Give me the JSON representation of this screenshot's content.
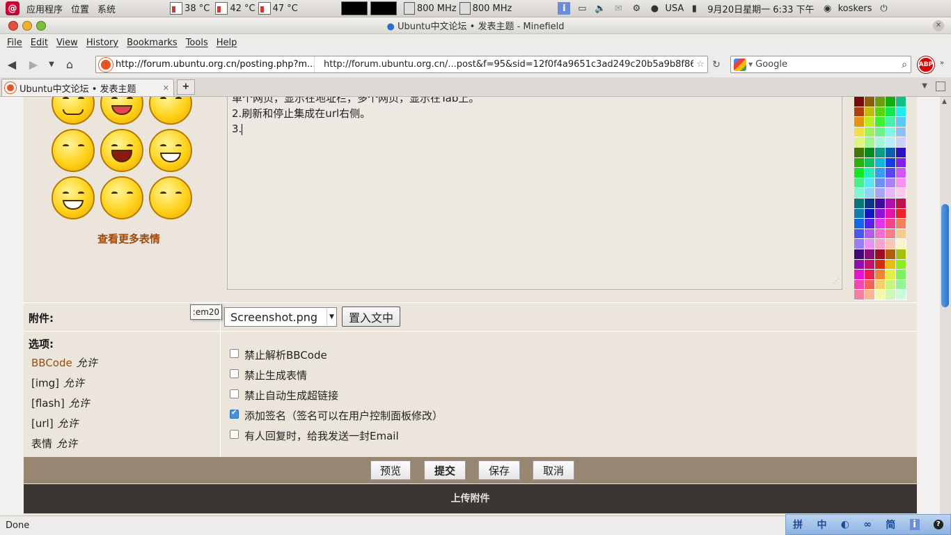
{
  "panel": {
    "apps": "应用程序",
    "places": "位置",
    "system": "系统",
    "temps": [
      "38 °C",
      "42 °C",
      "47 °C"
    ],
    "cpu_freqs": [
      "800 MHz",
      "800 MHz"
    ],
    "keyboard": "USA",
    "datetime": "9月20日星期一   6:33 下午",
    "user": "koskers"
  },
  "window": {
    "title": "Ubuntu中文论坛 • 发表主题 - Minefield"
  },
  "menu": [
    "File",
    "Edit",
    "View",
    "History",
    "Bookmarks",
    "Tools",
    "Help"
  ],
  "nav": {
    "url_short": "http://forum.ubuntu.org.cn/posting.php?m...",
    "url_full": "http://forum.ubuntu.org.cn/...post&f=95&sid=12f0f4a9651c3ad249c20b5a9b8f8629#",
    "search_placeholder": "Google",
    "abp": "ABP"
  },
  "tab": {
    "label": "Ubuntu中文论坛 • 发表主题"
  },
  "editor": {
    "lines": [
      "单个网页，显示在地址栏，多个网页，显示在Tab上。",
      "2.刷新和停止集成在url右侧。",
      "3."
    ]
  },
  "smileys": {
    "more_label": "查看更多表情",
    "tooltip": ":em20"
  },
  "attachment": {
    "label": "附件:",
    "file": "Screenshot.png",
    "place_button": "置入文中"
  },
  "options": {
    "label": "选项:",
    "perms": [
      {
        "key": "BBCode",
        "value": "允许"
      },
      {
        "key": "[img]",
        "value": "允许"
      },
      {
        "key": "[flash]",
        "value": "允许"
      },
      {
        "key": "[url]",
        "value": "允许"
      },
      {
        "key": "表情",
        "value": "允许"
      }
    ],
    "checks": [
      {
        "label": "禁止解析BBCode",
        "checked": false
      },
      {
        "label": "禁止生成表情",
        "checked": false
      },
      {
        "label": "禁止自动生成超链接",
        "checked": false
      },
      {
        "label": "添加签名（签名可以在用户控制面板修改）",
        "checked": true
      },
      {
        "label": "有人回复时，给我发送一封Email",
        "checked": false
      }
    ]
  },
  "buttons": {
    "preview": "预览",
    "submit": "提交",
    "save": "保存",
    "cancel": "取消"
  },
  "upload_header": "上传附件",
  "status": "Done",
  "ime": [
    "拼",
    "中",
    "◐",
    "∞",
    "简",
    "i",
    "?"
  ],
  "colors": {
    "accent_link": "#9c4a0e",
    "button_bar": "#968672",
    "upload_bar": "#3a3632"
  }
}
